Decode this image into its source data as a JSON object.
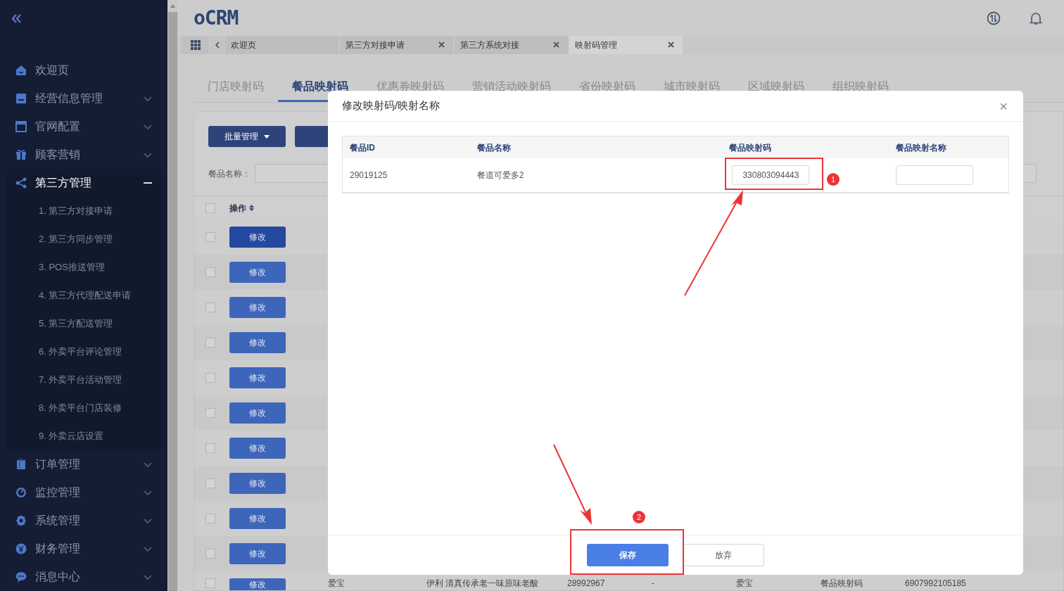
{
  "logo": "oCRM",
  "sidebar": {
    "items": [
      {
        "kind": "link",
        "label": "欢迎页"
      },
      {
        "kind": "group",
        "label": "经营信息管理",
        "expanded": false
      },
      {
        "kind": "group",
        "label": "官网配置",
        "expanded": false
      },
      {
        "kind": "group",
        "label": "顾客营销",
        "expanded": false
      },
      {
        "kind": "group",
        "label": "第三方管理",
        "expanded": true,
        "children": [
          {
            "label": "1. 第三方对接申请"
          },
          {
            "label": "2. 第三方同步管理"
          },
          {
            "label": "3. POS推送管理"
          },
          {
            "label": "4. 第三方代理配送申请"
          },
          {
            "label": "5. 第三方配送管理"
          },
          {
            "label": "6. 外卖平台评论管理"
          },
          {
            "label": "7. 外卖平台活动管理"
          },
          {
            "label": "8. 外卖平台门店装修"
          },
          {
            "label": "9. 外卖云店设置"
          }
        ]
      },
      {
        "kind": "group",
        "label": "订单管理",
        "expanded": false
      },
      {
        "kind": "group",
        "label": "监控管理",
        "expanded": false
      },
      {
        "kind": "group",
        "label": "系统管理",
        "expanded": false
      },
      {
        "kind": "group",
        "label": "财务管理",
        "expanded": false
      },
      {
        "kind": "group",
        "label": "消息中心",
        "expanded": false
      }
    ]
  },
  "page_tabs": [
    {
      "label": "欢迎页",
      "closable": false,
      "selected": false
    },
    {
      "label": "第三方对接申请",
      "closable": true,
      "selected": false
    },
    {
      "label": "第三方系统对接",
      "closable": true,
      "selected": false
    },
    {
      "label": "映射码管理",
      "closable": true,
      "selected": true
    }
  ],
  "sub_tabs": [
    {
      "label": "门店映射码",
      "selected": false
    },
    {
      "label": "餐品映射码",
      "selected": true
    },
    {
      "label": "优惠券映射码",
      "selected": false
    },
    {
      "label": "营销活动映射码",
      "selected": false
    },
    {
      "label": "省份映射码",
      "selected": false
    },
    {
      "label": "城市映射码",
      "selected": false
    },
    {
      "label": "区域映射码",
      "selected": false
    },
    {
      "label": "组织映射码",
      "selected": false
    }
  ],
  "toolbar": {
    "batch_button": "批量管理",
    "filter_label": "餐品名称："
  },
  "table": {
    "action_column": "操作",
    "all_checked": false,
    "rows": [
      {
        "action": "修改",
        "hovered": true,
        "checked": false
      },
      {
        "action": "修改",
        "hovered": false,
        "checked": false
      },
      {
        "action": "修改",
        "hovered": false,
        "checked": false
      },
      {
        "action": "修改",
        "hovered": false,
        "checked": false
      },
      {
        "action": "修改",
        "hovered": false,
        "checked": false
      },
      {
        "action": "修改",
        "hovered": false,
        "checked": false
      },
      {
        "action": "修改",
        "hovered": false,
        "checked": false
      },
      {
        "action": "修改",
        "hovered": false,
        "checked": false
      },
      {
        "action": "修改",
        "hovered": false,
        "checked": false
      },
      {
        "action": "修改",
        "hovered": false,
        "checked": false
      },
      {
        "action": "修改",
        "hovered": false,
        "checked": false,
        "cells": [
          "爱宝",
          "伊利 清真传承老一味原味老酸",
          "28992967",
          "-",
          "爱宝",
          "餐品映射码",
          "6907992105185"
        ]
      }
    ]
  },
  "modal": {
    "title": "修改映射码/映射名称",
    "close": "×",
    "columns": [
      "餐品ID",
      "餐品名称",
      "餐品映射码",
      "餐品映射名称"
    ],
    "rows": [
      {
        "id": "29019125",
        "name": "餐道可爱多2",
        "code": "330803094443"
      }
    ],
    "buttons": [
      {
        "label": "保存",
        "kind": "primary"
      },
      {
        "label": "放弃",
        "kind": "default"
      }
    ]
  },
  "annotations": [
    {
      "number": "1"
    },
    {
      "number": "2"
    }
  ]
}
